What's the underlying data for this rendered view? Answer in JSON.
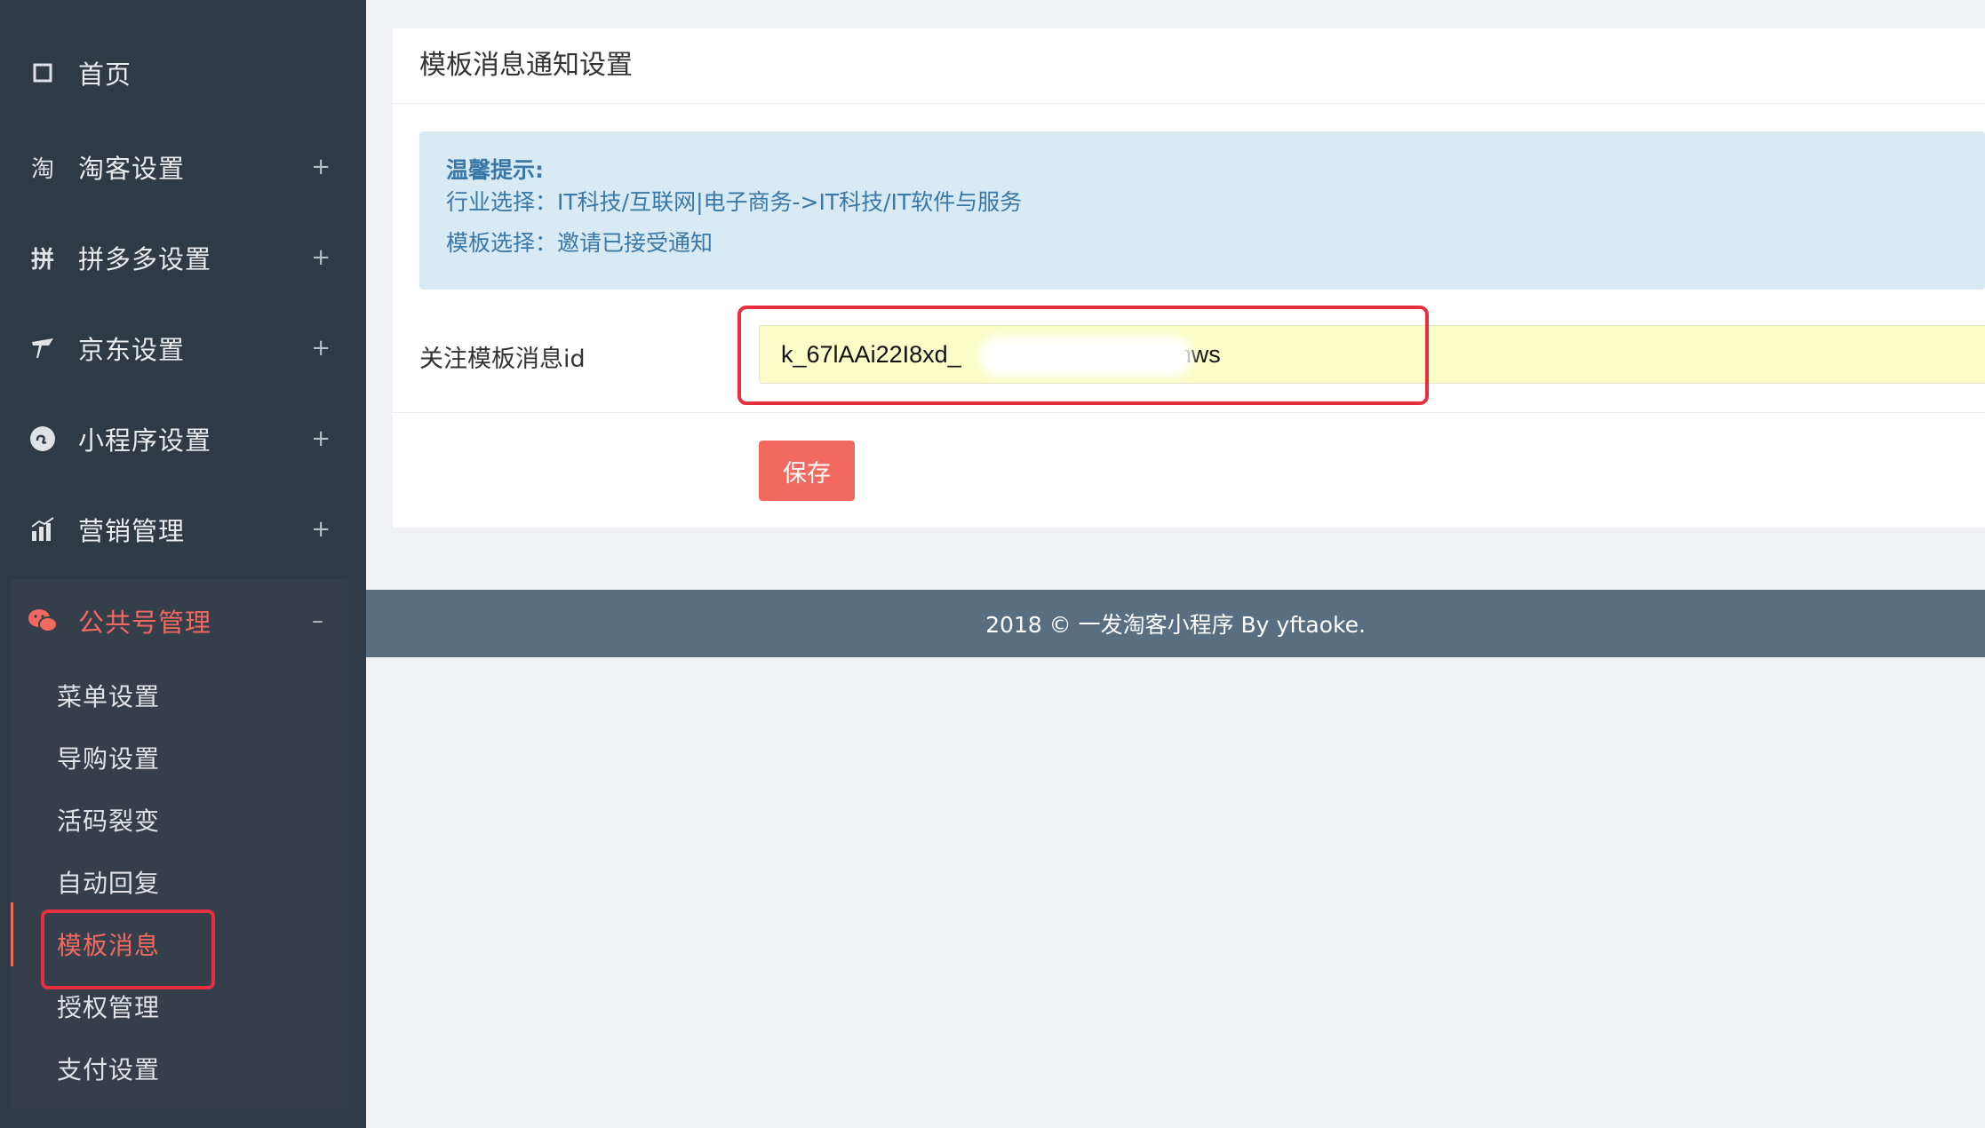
{
  "sidebar": {
    "home": {
      "label": "首页",
      "icon": "square-icon"
    },
    "items": [
      {
        "label": "淘客设置",
        "icon": "taobao-icon",
        "toggle": "+"
      },
      {
        "label": "拼多多设置",
        "icon": "pinduoduo-icon",
        "toggle": "+"
      },
      {
        "label": "京东设置",
        "icon": "jd-icon",
        "toggle": "+"
      },
      {
        "label": "小程序设置",
        "icon": "miniprogram-icon",
        "toggle": "+"
      },
      {
        "label": "营销管理",
        "icon": "chart-icon",
        "toggle": "+"
      }
    ],
    "group": {
      "label": "公共号管理",
      "icon": "wechat-icon",
      "toggle": "–",
      "sub_items": [
        {
          "label": "菜单设置"
        },
        {
          "label": "导购设置"
        },
        {
          "label": "活码裂变"
        },
        {
          "label": "自动回复"
        },
        {
          "label": "模板消息",
          "active": true
        },
        {
          "label": "授权管理"
        },
        {
          "label": "支付设置"
        }
      ]
    }
  },
  "main": {
    "title": "模板消息通知设置",
    "tip": {
      "title": "温馨提示:",
      "lines": [
        "行业选择：IT科技/互联网|电子商务->IT科技/IT软件与服务",
        "模板选择：邀请已接受通知"
      ]
    },
    "form": {
      "label": "关注模板消息id",
      "value": "k_67lAAi22I8xd_          OyjXCgXHVamws",
      "save_label": "保存"
    }
  },
  "footer": {
    "text": "2018 © 一发淘客小程序 By yftaoke."
  },
  "colors": {
    "sidebar_bg": "#2f3a47",
    "accent": "#f26a5f",
    "tip_bg": "#d8eaf4",
    "tip_text": "#3a78a8",
    "input_bg": "#fafdc8",
    "highlight": "#e6303f",
    "footer_bg": "#5a6e82"
  }
}
